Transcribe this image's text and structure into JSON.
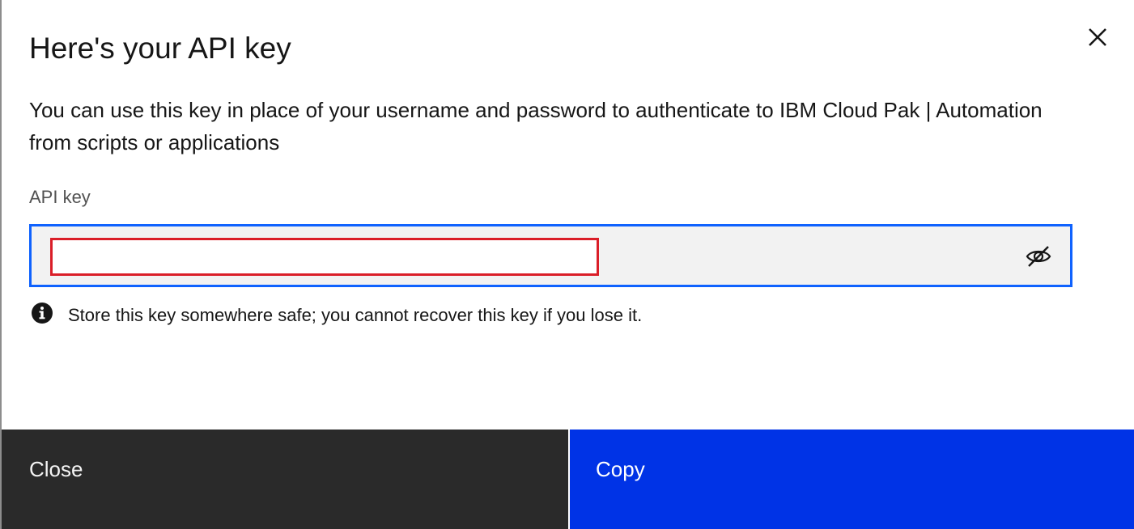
{
  "dialog": {
    "title": "Here's your API key",
    "description": "You can use this key in place of your username and password to authenticate to IBM Cloud Pak | Automation from scripts or applications",
    "close_icon": "close-icon"
  },
  "api_key_field": {
    "label": "API key",
    "value": "",
    "visibility_icon": "eye-slash-icon"
  },
  "helper": {
    "icon": "info-icon",
    "text": "Store this key somewhere safe; you cannot recover this key if you lose it."
  },
  "footer": {
    "close_label": "Close",
    "copy_label": "Copy"
  },
  "colors": {
    "primary": "#0033e6",
    "secondary": "#2a2a2a",
    "focus_border": "#0f62fe",
    "redaction_border": "#da1e28"
  }
}
